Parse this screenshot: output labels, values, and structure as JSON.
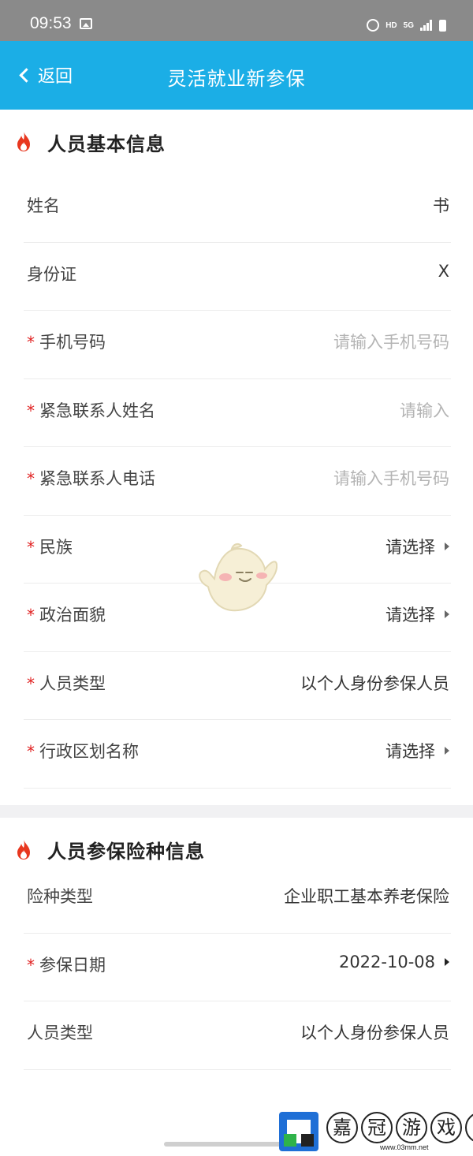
{
  "status_bar": {
    "time": "09:53",
    "network_hd": "HD",
    "network_5g": "5G"
  },
  "nav": {
    "back_label": "返回",
    "title": "灵活就业新参保"
  },
  "section_basic": {
    "title": "人员基本信息",
    "rows": [
      {
        "label": "姓名",
        "required": false,
        "value": "书",
        "kind": "text"
      },
      {
        "label": "身份证",
        "required": false,
        "value": "X",
        "kind": "text"
      },
      {
        "label": "手机号码",
        "required": true,
        "placeholder": "请输入手机号码",
        "kind": "input"
      },
      {
        "label": "紧急联系人姓名",
        "required": true,
        "placeholder": "请输入",
        "kind": "input"
      },
      {
        "label": "紧急联系人电话",
        "required": true,
        "placeholder": "请输入手机号码",
        "kind": "input"
      },
      {
        "label": "民族",
        "required": true,
        "value": "请选择",
        "kind": "select"
      },
      {
        "label": "政治面貌",
        "required": true,
        "value": "请选择",
        "kind": "select"
      },
      {
        "label": "人员类型",
        "required": true,
        "value": "以个人身份参保人员",
        "kind": "text"
      },
      {
        "label": "行政区划名称",
        "required": true,
        "value": "请选择",
        "kind": "select"
      }
    ]
  },
  "section_insurance": {
    "title": "人员参保险种信息",
    "rows": [
      {
        "label": "险种类型",
        "required": false,
        "value": "企业职工基本养老保险",
        "kind": "text"
      },
      {
        "label": "参保日期",
        "required": true,
        "value": "2022-10-08",
        "kind": "select"
      },
      {
        "label": "人员类型",
        "required": false,
        "value": "以个人身份参保人员",
        "kind": "text"
      }
    ]
  },
  "required_mark": "*",
  "watermark": {
    "chars": [
      "嘉",
      "冠",
      "游",
      "戏",
      "网"
    ],
    "url": "www.03mm.net"
  },
  "colors": {
    "nav_bg": "#1baee6",
    "required": "#e02020",
    "fire": "#e8371f",
    "placeholder": "#b4b4b4"
  }
}
